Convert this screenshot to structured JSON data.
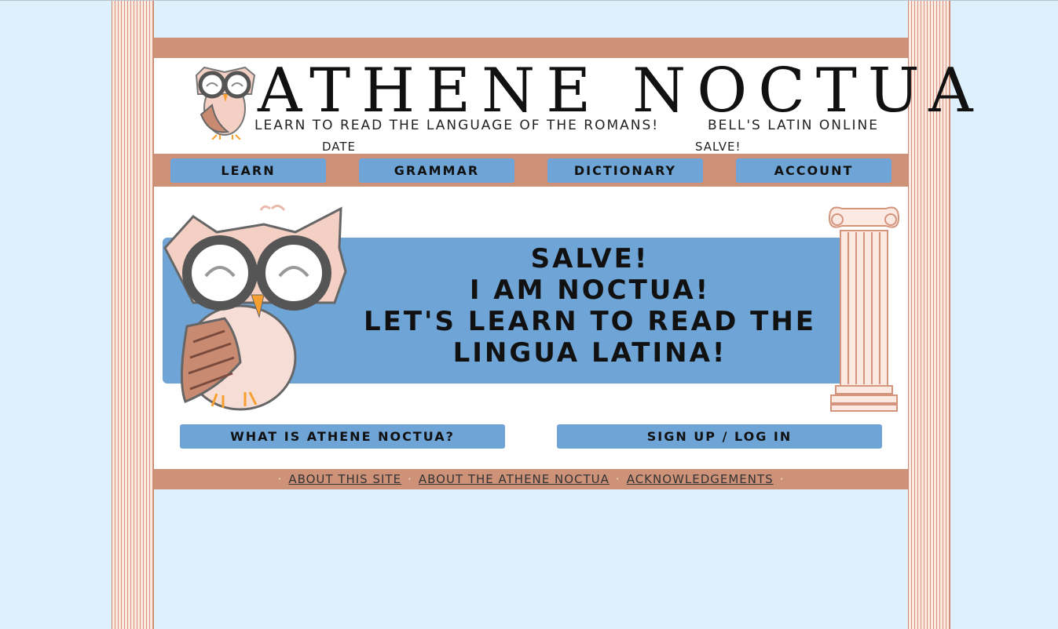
{
  "header": {
    "title": "ATHENE NOCTUA",
    "tagline": "LEARN TO READ THE LANGUAGE OF THE ROMANS!",
    "tagline_right": "BELL'S LATIN ONLINE",
    "date_label": "DATE",
    "greeting": "SALVE!"
  },
  "nav": {
    "items": [
      {
        "label": "LEARN"
      },
      {
        "label": "GRAMMAR"
      },
      {
        "label": "DICTIONARY"
      },
      {
        "label": "ACCOUNT"
      }
    ]
  },
  "banner": {
    "line1": "SALVE!",
    "line2": "I AM NOCTUA!",
    "line3": "LET'S LEARN TO READ THE",
    "line4": "LINGUA LATINA!"
  },
  "actions": {
    "what_is": "WHAT IS ATHENE NOCTUA?",
    "signup": "SIGN UP / LOG IN"
  },
  "footer": {
    "separator": "·",
    "links": [
      {
        "label": "ABOUT THIS SITE"
      },
      {
        "label": "ABOUT THE ATHENE NOCTUA"
      },
      {
        "label": "ACKNOWLEDGEMENTS"
      }
    ]
  },
  "colors": {
    "background": "#dff0fd",
    "accent_band": "#cd9278",
    "button_blue": "#6fa4d6"
  },
  "icons": [
    "owl-logo-icon",
    "owl-mascot-icon",
    "ionic-column-icon",
    "column-pillar"
  ]
}
